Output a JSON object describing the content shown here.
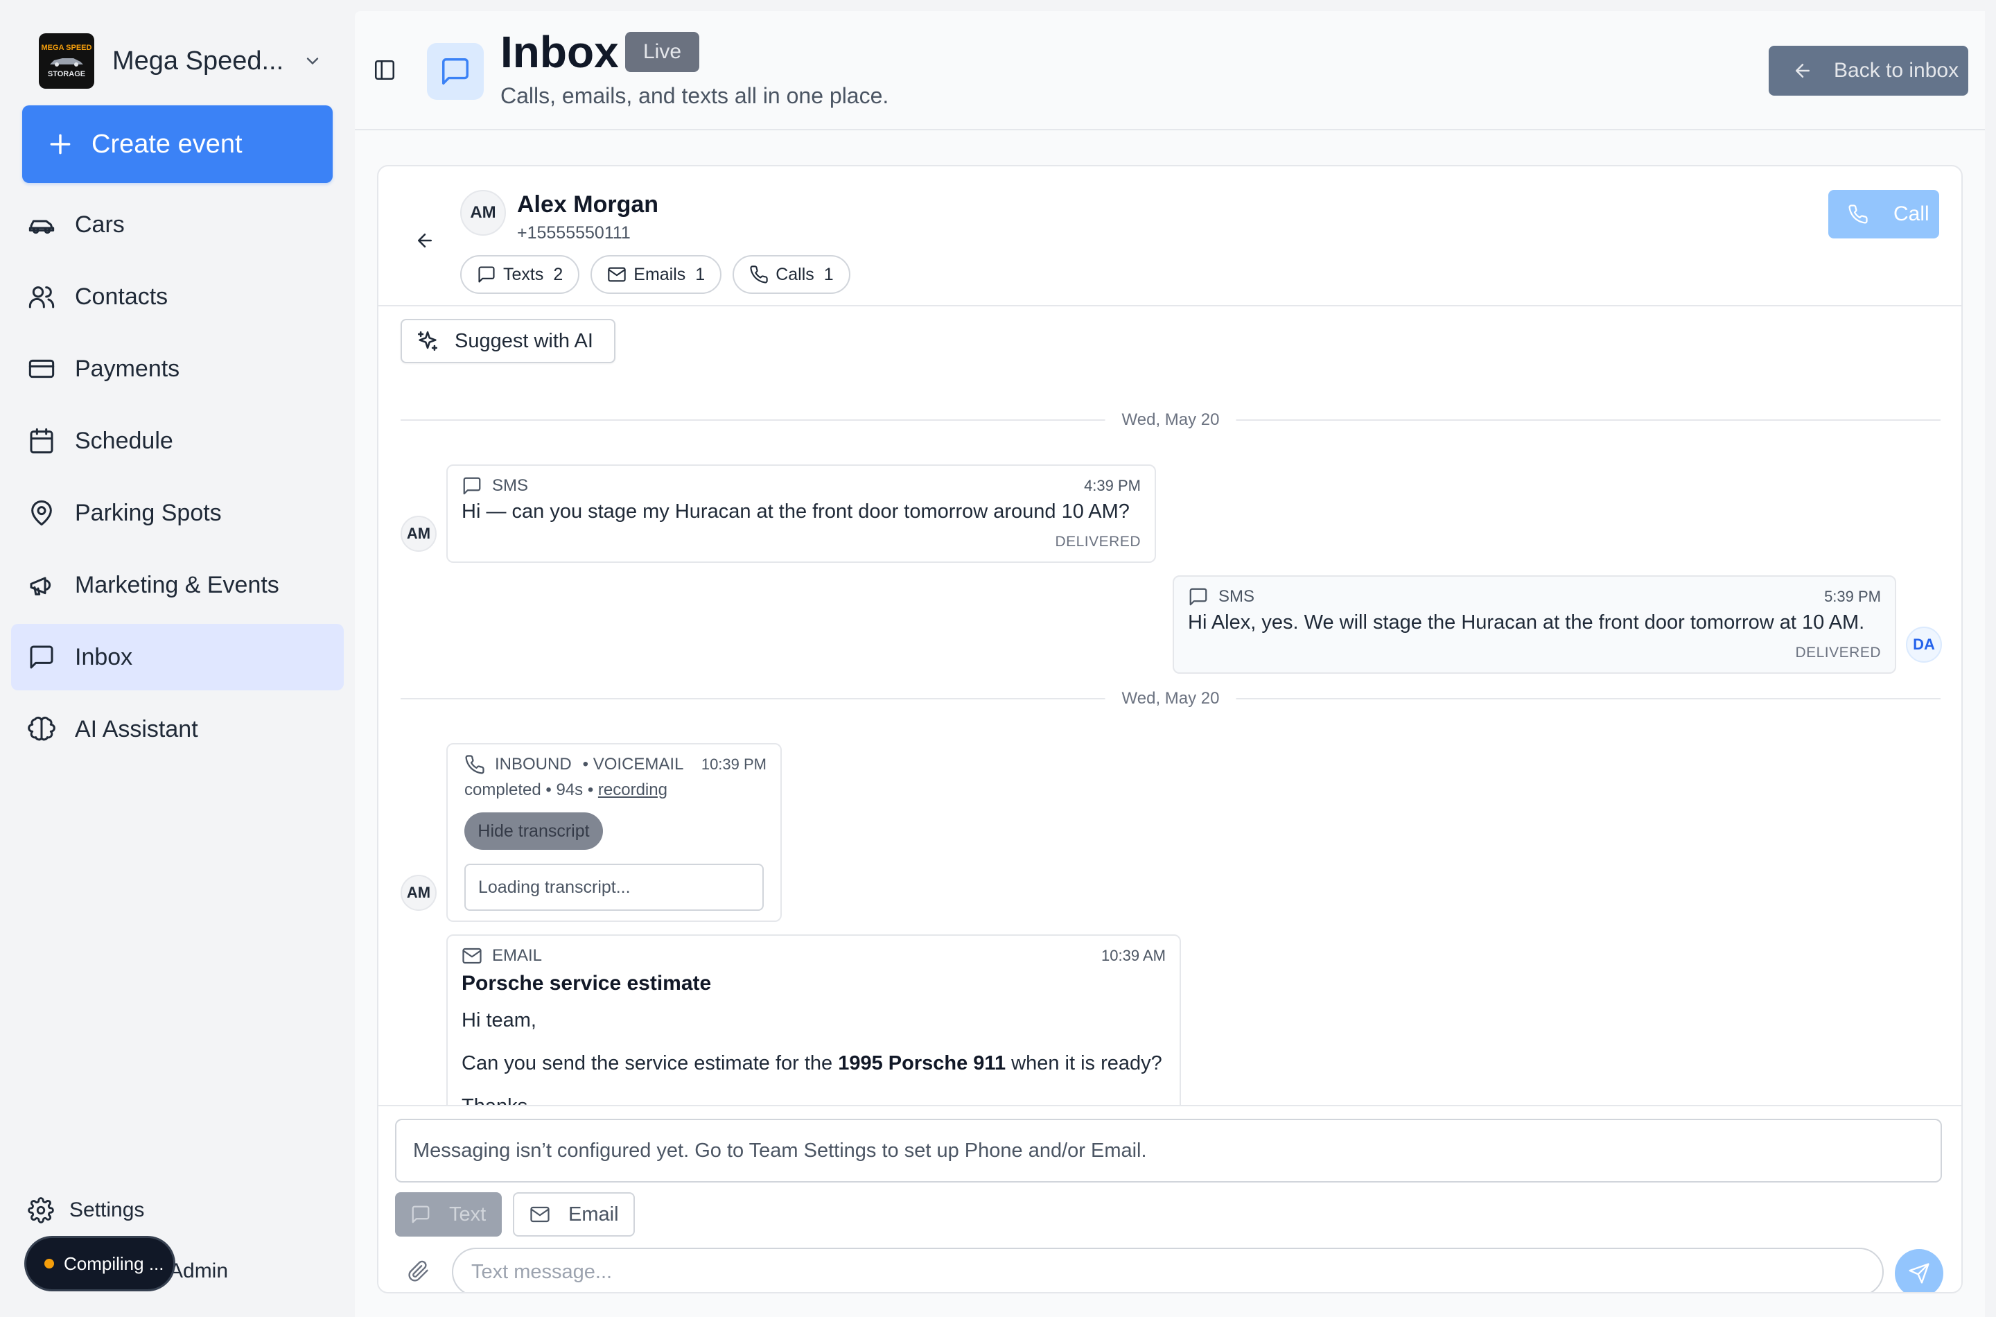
{
  "brand": {
    "name": "Mega Speed...",
    "logo_top": "MEGA SPEED",
    "logo_bottom": "STORAGE"
  },
  "sidebar": {
    "create_label": "Create event",
    "items": [
      {
        "label": "Cars",
        "icon": "car-icon"
      },
      {
        "label": "Contacts",
        "icon": "users-icon"
      },
      {
        "label": "Payments",
        "icon": "credit-card-icon"
      },
      {
        "label": "Schedule",
        "icon": "calendar-icon"
      },
      {
        "label": "Parking Spots",
        "icon": "map-pin-icon"
      },
      {
        "label": "Marketing & Events",
        "icon": "megaphone-icon"
      },
      {
        "label": "Inbox",
        "icon": "message-square-icon",
        "active": true
      },
      {
        "label": "AI Assistant",
        "icon": "brain-icon"
      }
    ],
    "settings_label": "Settings",
    "admin_label": "Admin",
    "compiling_label": "Compiling ..."
  },
  "header": {
    "title": "Inbox",
    "badge": "Live",
    "subtitle": "Calls, emails, and texts all in one place.",
    "back_label": "Back to inbox"
  },
  "contact": {
    "initials": "AM",
    "name": "Alex Morgan",
    "phone": "+15555550111",
    "call_label": "Call",
    "chips": [
      {
        "label": "Texts",
        "count": "2"
      },
      {
        "label": "Emails",
        "count": "1"
      },
      {
        "label": "Calls",
        "count": "1"
      }
    ]
  },
  "thread": {
    "suggest_label": "Suggest with AI",
    "day_labels": [
      "Wed, May 20",
      "Wed, May 20"
    ],
    "messages": [
      {
        "type": "SMS",
        "time": "4:39 PM",
        "body": "Hi — can you stage my Huracan at the front door tomorrow around 10 AM?",
        "status": "DELIVERED",
        "avatar": "AM"
      },
      {
        "type": "SMS",
        "time": "5:39 PM",
        "body": "Hi Alex, yes. We will stage the Huracan at the front door tomorrow at 10 AM.",
        "status": "DELIVERED",
        "avatar": "DA"
      }
    ],
    "voicemail": {
      "direction": "INBOUND",
      "kind": "• VOICEMAIL",
      "time": "10:39 PM",
      "meta_prefix": "completed • 94s • ",
      "recording_label": "recording",
      "hide_label": "Hide transcript",
      "transcript": "Loading transcript...",
      "avatar": "AM"
    },
    "email": {
      "type": "EMAIL",
      "time": "10:39 AM",
      "subject": "Porsche service estimate",
      "greeting": "Hi team,",
      "line_before": "Can you send the service estimate for the ",
      "line_bold": "1995 Porsche 911",
      "line_after": " when it is ready?",
      "sign": "Thanks,"
    }
  },
  "composer": {
    "notice": "Messaging isn’t configured yet. Go to Team Settings to set up Phone and/or Email.",
    "text_label": "Text",
    "email_label": "Email",
    "placeholder": "Text message..."
  },
  "colors": {
    "accent": "#3b82f6",
    "active_nav": "#e0e7ff",
    "back_button": "#64748b"
  }
}
